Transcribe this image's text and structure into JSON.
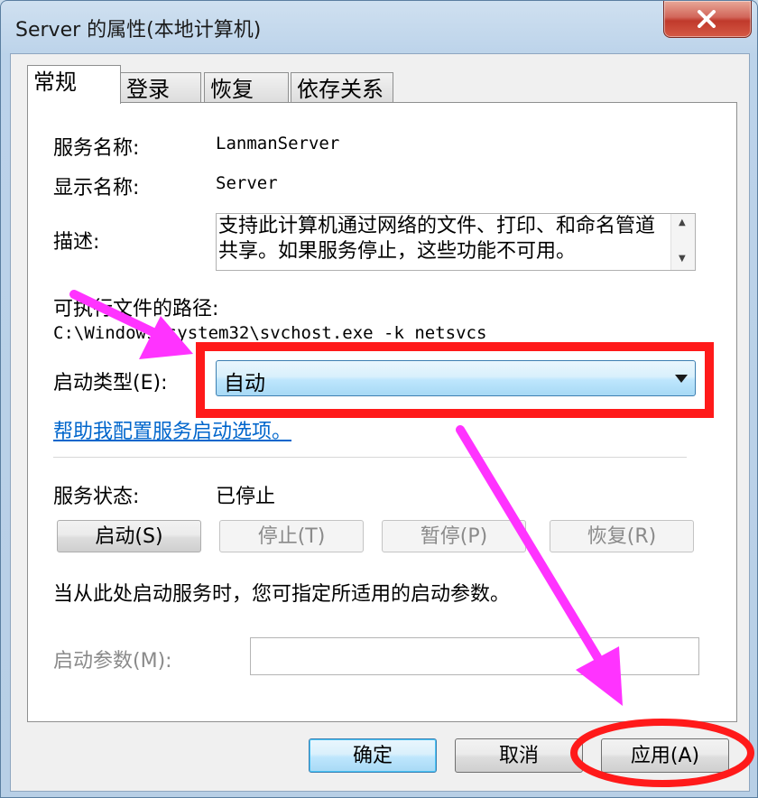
{
  "window": {
    "title": "Server 的属性(本地计算机)",
    "close_icon": "close-icon"
  },
  "tabs": [
    {
      "label": "常规",
      "active": true
    },
    {
      "label": "登录",
      "active": false
    },
    {
      "label": "恢复",
      "active": false
    },
    {
      "label": "依存关系",
      "active": false
    }
  ],
  "general": {
    "service_name_label": "服务名称:",
    "service_name_value": "LanmanServer",
    "display_name_label": "显示名称:",
    "display_name_value": "Server",
    "description_label": "描述:",
    "description_value": "支持此计算机通过网络的文件、打印、和命名管道共享。如果服务停止，这些功能不可用。",
    "exe_path_label": "可执行文件的路径:",
    "exe_path_value": "C:\\Windows\\system32\\svchost.exe -k netsvcs",
    "startup_type_label": "启动类型(E):",
    "startup_type_value": "自动",
    "help_link": "帮助我配置服务启动选项。",
    "service_status_label": "服务状态:",
    "service_status_value": "已停止",
    "start_button": "启动(S)",
    "stop_button": "停止(T)",
    "pause_button": "暂停(P)",
    "resume_button": "恢复(R)",
    "hint_text": "当从此处启动服务时，您可指定所适用的启动参数。",
    "start_params_label": "启动参数(M):",
    "start_params_value": ""
  },
  "footer": {
    "ok_button": "确定",
    "cancel_button": "取消",
    "apply_button": "应用(A)"
  },
  "annotation_colors": {
    "arrow": "#ff33ff",
    "highlight": "#ff1a1a"
  }
}
